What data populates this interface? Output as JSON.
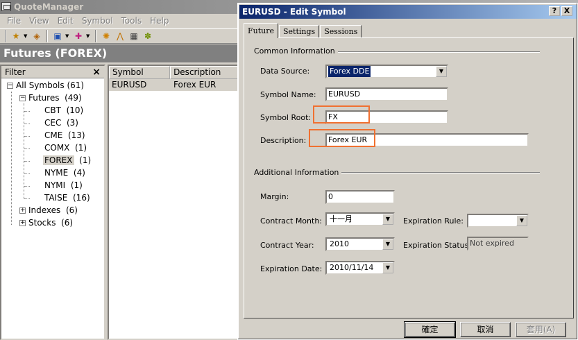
{
  "app": {
    "title": "QuoteManager"
  },
  "menu": [
    "File",
    "View",
    "Edit",
    "Symbol",
    "Tools",
    "Help"
  ],
  "toolbar_icons": [
    "new-symbol-icon",
    "chevron-down-icon",
    "import-icon",
    "export-icon",
    "chevron-down-icon",
    "add-icon",
    "chevron-down-icon",
    "sun-icon",
    "split-icon",
    "calendar-icon",
    "gear-icon"
  ],
  "section_title": "Futures (FOREX)",
  "filter": {
    "header": "Filter",
    "close": "×",
    "tree": {
      "root": {
        "label": "All Symbols",
        "count": "(61)"
      },
      "futures": {
        "label": "Futures",
        "count": "(49)"
      },
      "children": [
        {
          "label": "CBT",
          "count": "(10)"
        },
        {
          "label": "CEC",
          "count": "(3)"
        },
        {
          "label": "CME",
          "count": "(13)"
        },
        {
          "label": "COMX",
          "count": "(1)"
        },
        {
          "label": "FOREX",
          "count": "(1)"
        },
        {
          "label": "NYME",
          "count": "(4)"
        },
        {
          "label": "NYMI",
          "count": "(1)"
        },
        {
          "label": "TAISE",
          "count": "(16)"
        }
      ],
      "indexes": {
        "label": "Indexes",
        "count": "(6)"
      },
      "stocks": {
        "label": "Stocks",
        "count": "(6)"
      }
    }
  },
  "list": {
    "columns": [
      "Symbol",
      "Description"
    ],
    "rows": [
      {
        "symbol": "EURUSD",
        "description": "Forex EUR"
      }
    ]
  },
  "dialog": {
    "title": "EURUSD - Edit Symbol",
    "help_btn": "?",
    "close_btn": "X",
    "tabs": [
      "Future",
      "Settings",
      "Sessions"
    ],
    "common_group": "Common Information",
    "additional_group": "Additional Information",
    "fields": {
      "data_source": {
        "label": "Data Source:",
        "value": "Forex DDE"
      },
      "symbol_name": {
        "label": "Symbol Name:",
        "value": "EURUSD"
      },
      "symbol_root": {
        "label": "Symbol Root:",
        "value": "FX"
      },
      "description": {
        "label": "Description:",
        "value": "Forex EUR"
      },
      "margin": {
        "label": "Margin:",
        "value": "0"
      },
      "contract_month": {
        "label": "Contract Month:",
        "value": "十一月"
      },
      "expiration_rule": {
        "label": "Expiration Rule:",
        "value": ""
      },
      "contract_year": {
        "label": "Contract Year:",
        "value": "2010"
      },
      "expiration_status": {
        "label": "Expiration Status",
        "value": "Not expired"
      },
      "expiration_date": {
        "label": "Expiration Date:",
        "value": "2010/11/14"
      }
    },
    "buttons": {
      "ok": "確定",
      "cancel": "取消",
      "apply": "套用(A)"
    }
  },
  "colors": {
    "dialog_title": "#0a246a",
    "highlight": "#f07030",
    "section_header": "#808080"
  }
}
